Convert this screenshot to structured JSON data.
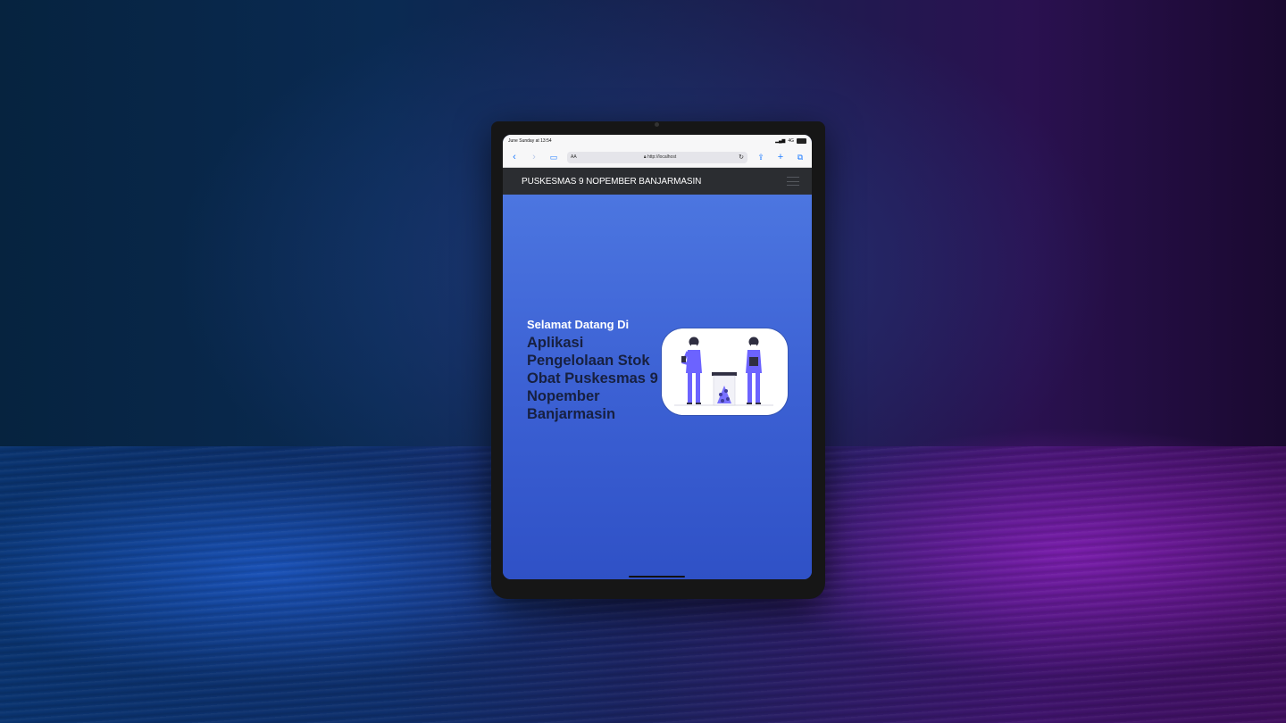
{
  "statusbar": {
    "time": "June Sunday at 13:54",
    "signal": "4G"
  },
  "browser": {
    "reader_label": "AA",
    "url": "http://localhost"
  },
  "navbar": {
    "brand": "PUSKESMAS 9 NOPEMBER BANJARMASIN"
  },
  "hero": {
    "welcome": "Selamat Datang Di",
    "title": "Aplikasi Pengelolaan Stok Obat Puskesmas 9 Nopember Banjarmasin"
  },
  "colors": {
    "navbar_bg": "#2b2d31",
    "hero_top": "#4c76e0",
    "hero_bottom": "#2f51c6",
    "title_text": "#172040",
    "figure_purple": "#6c63ff"
  },
  "icons": {
    "back": "chevron-left-icon",
    "forward": "chevron-right-icon",
    "bookmarks": "book-icon",
    "lock": "lock-icon",
    "reload": "reload-icon",
    "share": "share-icon",
    "new_tab": "plus-icon",
    "tabs": "tabs-icon",
    "menu": "hamburger-icon"
  }
}
